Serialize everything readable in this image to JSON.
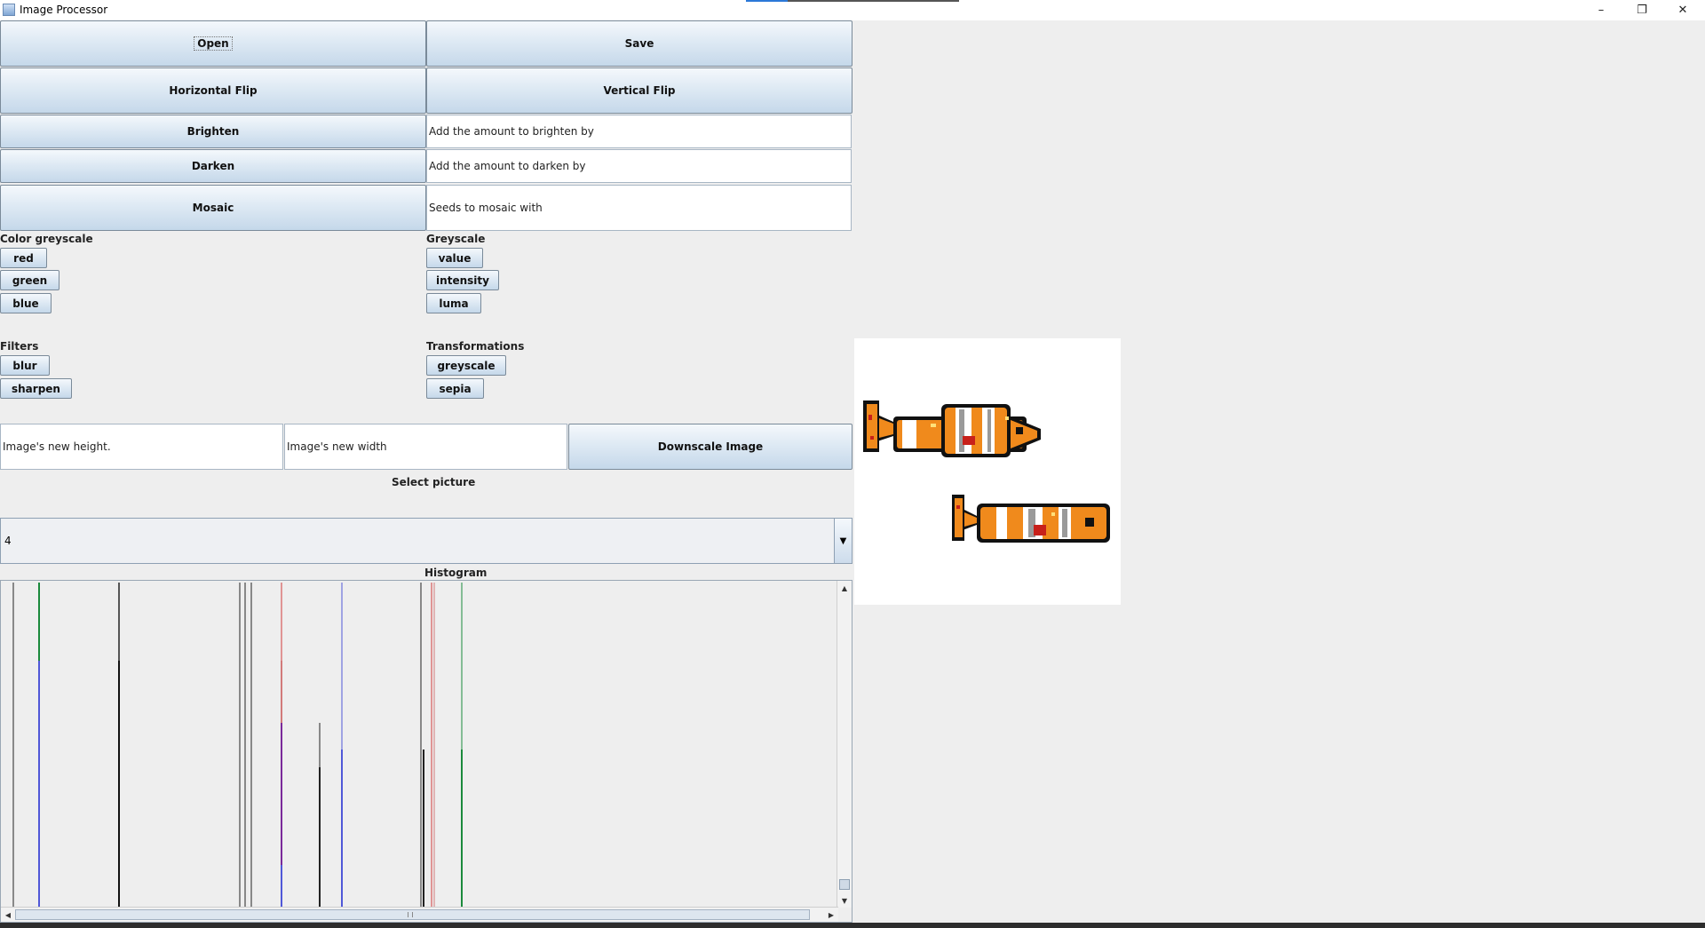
{
  "window": {
    "title": "Image Processor",
    "controls": [
      "–",
      "❐",
      "✕"
    ]
  },
  "buttons": {
    "open": "Open",
    "save": "Save",
    "horizontal_flip": "Horizontal Flip",
    "vertical_flip": "Vertical Flip",
    "brighten": "Brighten",
    "darken": "Darken",
    "mosaic": "Mosaic",
    "downscale": "Downscale Image"
  },
  "inputs": {
    "brighten_amount": "Add the amount to brighten by",
    "darken_amount": "Add the amount to darken by",
    "mosaic_seeds": "Seeds to mosaic with",
    "new_height": "Image's new height.",
    "new_width": "Image's new width"
  },
  "color_greyscale": {
    "label": "Color greyscale",
    "options": [
      "red",
      "green",
      "blue"
    ]
  },
  "greyscale": {
    "label": "Greyscale",
    "options": [
      "value",
      "intensity",
      "luma"
    ]
  },
  "filters": {
    "label": "Filters",
    "options": [
      "blur",
      "sharpen"
    ]
  },
  "transformations": {
    "label": "Transformations",
    "options": [
      "greyscale",
      "sepia"
    ]
  },
  "select_picture": {
    "label": "Select picture",
    "selected": "4"
  },
  "histogram": {
    "label": "Histogram"
  },
  "image": {
    "description_icon": "clownfish-pixel-art-icon"
  }
}
